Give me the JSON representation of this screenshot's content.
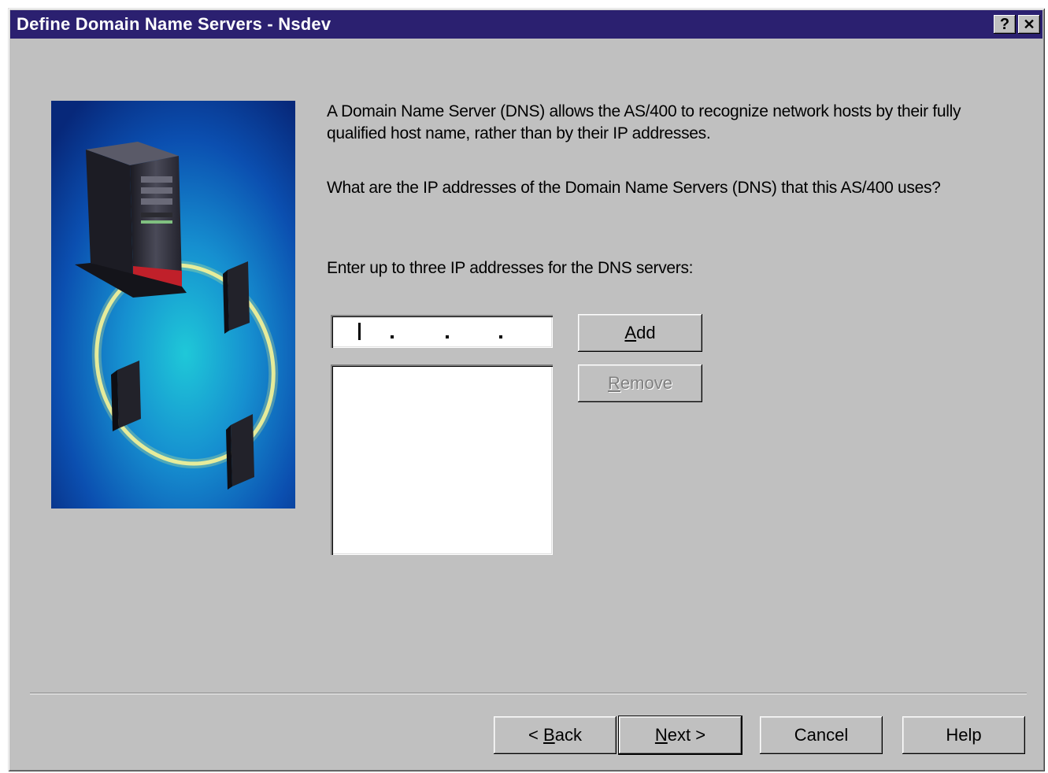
{
  "window": {
    "title": "Define Domain Name Servers - Nsdev",
    "help_glyph": "?",
    "close_glyph": "✕"
  },
  "content": {
    "intro": "A Domain Name Server (DNS) allows the AS/400 to recognize network hosts by their fully qualified host name, rather than by their IP addresses.",
    "question": "What are the IP addresses of the Domain Name Servers (DNS) that this AS/400 uses?",
    "instruction": "Enter up to three IP addresses for the DNS servers:"
  },
  "ip_input": {
    "value": ""
  },
  "dns_list": {
    "items": []
  },
  "buttons": {
    "add": {
      "mnemonic": "A",
      "rest": "dd"
    },
    "remove": {
      "mnemonic": "R",
      "rest": "emove",
      "enabled": false
    },
    "back": {
      "prefix": "< ",
      "mnemonic": "B",
      "rest": "ack"
    },
    "next": {
      "mnemonic": "N",
      "rest": "ext >"
    },
    "cancel": "Cancel",
    "help": "Help"
  },
  "icons": {
    "illustration": "server-network-illustration",
    "help": "help-icon",
    "close": "close-icon"
  },
  "colors": {
    "titlebar": "#2b2070",
    "dialog_face": "#c0c0c0",
    "illustration_bg": "#0a3a9a",
    "ring": "#e8e070"
  }
}
